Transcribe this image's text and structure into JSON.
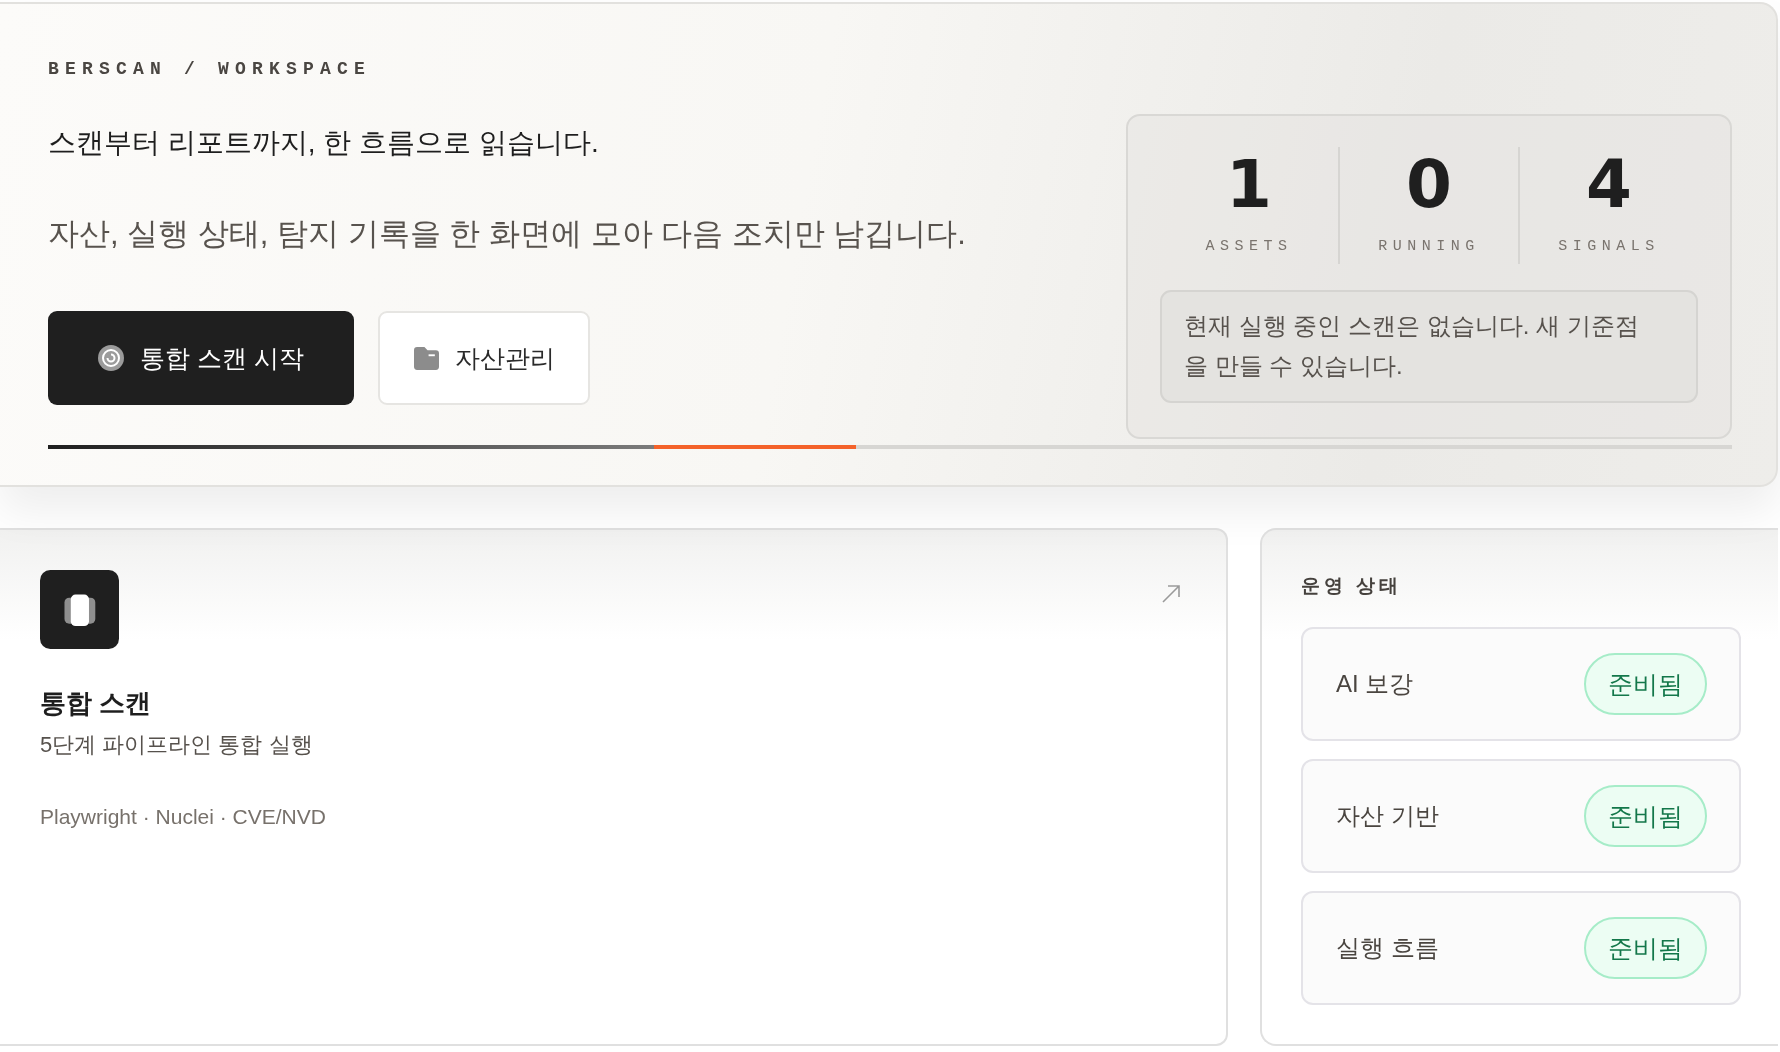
{
  "header": {
    "breadcrumb": "BERSCAN / WORKSPACE",
    "title": "스캔부터 리포트까지, 한 흐름으로 읽습니다.",
    "subtitle": "자산, 실행 상태, 탐지 기록을 한 화면에 모아 다음 조치만 남깁니다.",
    "buttons": [
      {
        "label": "통합 스캔 시작",
        "kind": "primary"
      },
      {
        "label": "자산관리",
        "kind": "secondary"
      }
    ],
    "progress": {
      "level": 0.48
    }
  },
  "stats": {
    "items": [
      {
        "value": "1",
        "label": "ASSETS"
      },
      {
        "value": "0",
        "label": "RUNNING"
      },
      {
        "value": "4",
        "label": "SIGNALS"
      }
    ],
    "note": "현재 실행 중인 스캔은 없습니다. 새 기준점을 만들 수 있습니다."
  },
  "scan_card": {
    "title": "통합 스캔",
    "description": "5단계 파이프라인 통합 실행",
    "tools": "Playwright · Nuclei · CVE/NVD"
  },
  "operations": {
    "title": "운영 상태",
    "items": [
      {
        "label": "AI 보강",
        "status": "준비됨"
      },
      {
        "label": "자산 기반",
        "status": "준비됨"
      },
      {
        "label": "실행 흐름",
        "status": "준비됨"
      }
    ]
  }
}
